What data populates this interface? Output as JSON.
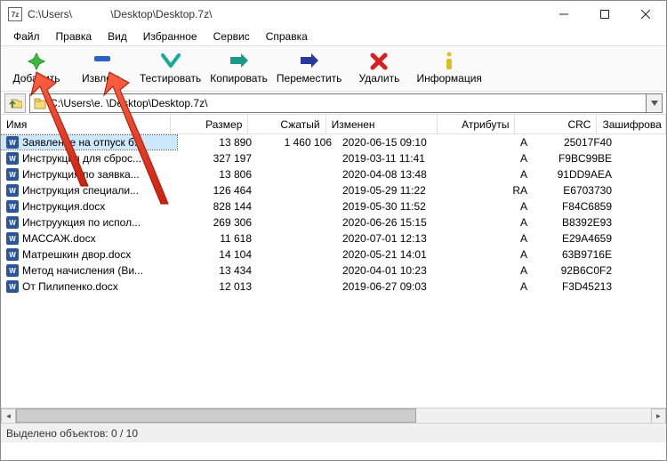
{
  "window": {
    "title": "C:\\Users\\             \\Desktop\\Desktop.7z\\",
    "app_icon_text": "7z"
  },
  "menu": {
    "items": [
      "Файл",
      "Правка",
      "Вид",
      "Избранное",
      "Сервис",
      "Справка"
    ]
  },
  "toolbar": {
    "add": "Добавить",
    "extract": "Извлечь",
    "test": "Тестировать",
    "copy": "Копировать",
    "move": "Переместить",
    "delete": "Удалить",
    "info": "Информация"
  },
  "path": {
    "value": "C:\\Users\\e.             \\Desktop\\Desktop.7z\\"
  },
  "columns": {
    "name": "Имя",
    "size": "Размер",
    "packed": "Сжатый",
    "modified": "Изменен",
    "attr": "Атрибуты",
    "crc": "CRC",
    "encrypted": "Зашифрова"
  },
  "rows": [
    {
      "name": "Заявление на отпуск б...",
      "size": "13 890",
      "packed": "1 460 106",
      "mod": "2020-06-15 09:10",
      "attr": "A",
      "crc": "25017F40",
      "selected": true
    },
    {
      "name": "Инструкция для сброс...",
      "size": "327 197",
      "packed": "",
      "mod": "2019-03-11 11:41",
      "attr": "A",
      "crc": "F9BC99BE",
      "selected": false
    },
    {
      "name": "Инструкция по заявка...",
      "size": "13 806",
      "packed": "",
      "mod": "2020-04-08 13:48",
      "attr": "A",
      "crc": "91DD9AEA",
      "selected": false
    },
    {
      "name": "Инструкция специали...",
      "size": "126 464",
      "packed": "",
      "mod": "2019-05-29 11:22",
      "attr": "RA",
      "crc": "E6703730",
      "selected": false
    },
    {
      "name": "Инструкция.docx",
      "size": "828 144",
      "packed": "",
      "mod": "2019-05-30 11:52",
      "attr": "A",
      "crc": "F84C6859",
      "selected": false
    },
    {
      "name": "Инструукция по испол...",
      "size": "269 306",
      "packed": "",
      "mod": "2020-06-26 15:15",
      "attr": "A",
      "crc": "B8392E93",
      "selected": false
    },
    {
      "name": "МАССАЖ.docx",
      "size": "11 618",
      "packed": "",
      "mod": "2020-07-01 12:13",
      "attr": "A",
      "crc": "E29A4659",
      "selected": false
    },
    {
      "name": "Матрешкин двор.docx",
      "size": "14 104",
      "packed": "",
      "mod": "2020-05-21 14:01",
      "attr": "A",
      "crc": "63B9716E",
      "selected": false
    },
    {
      "name": "Метод начисления (Ви...",
      "size": "13 434",
      "packed": "",
      "mod": "2020-04-01 10:23",
      "attr": "A",
      "crc": "92B6C0F2",
      "selected": false
    },
    {
      "name": "От Пилипенко.docx",
      "size": "12 013",
      "packed": "",
      "mod": "2019-06-27 09:03",
      "attr": "A",
      "crc": "F3D45213",
      "selected": false
    }
  ],
  "status": {
    "text": "Выделено объектов: 0 / 10"
  }
}
